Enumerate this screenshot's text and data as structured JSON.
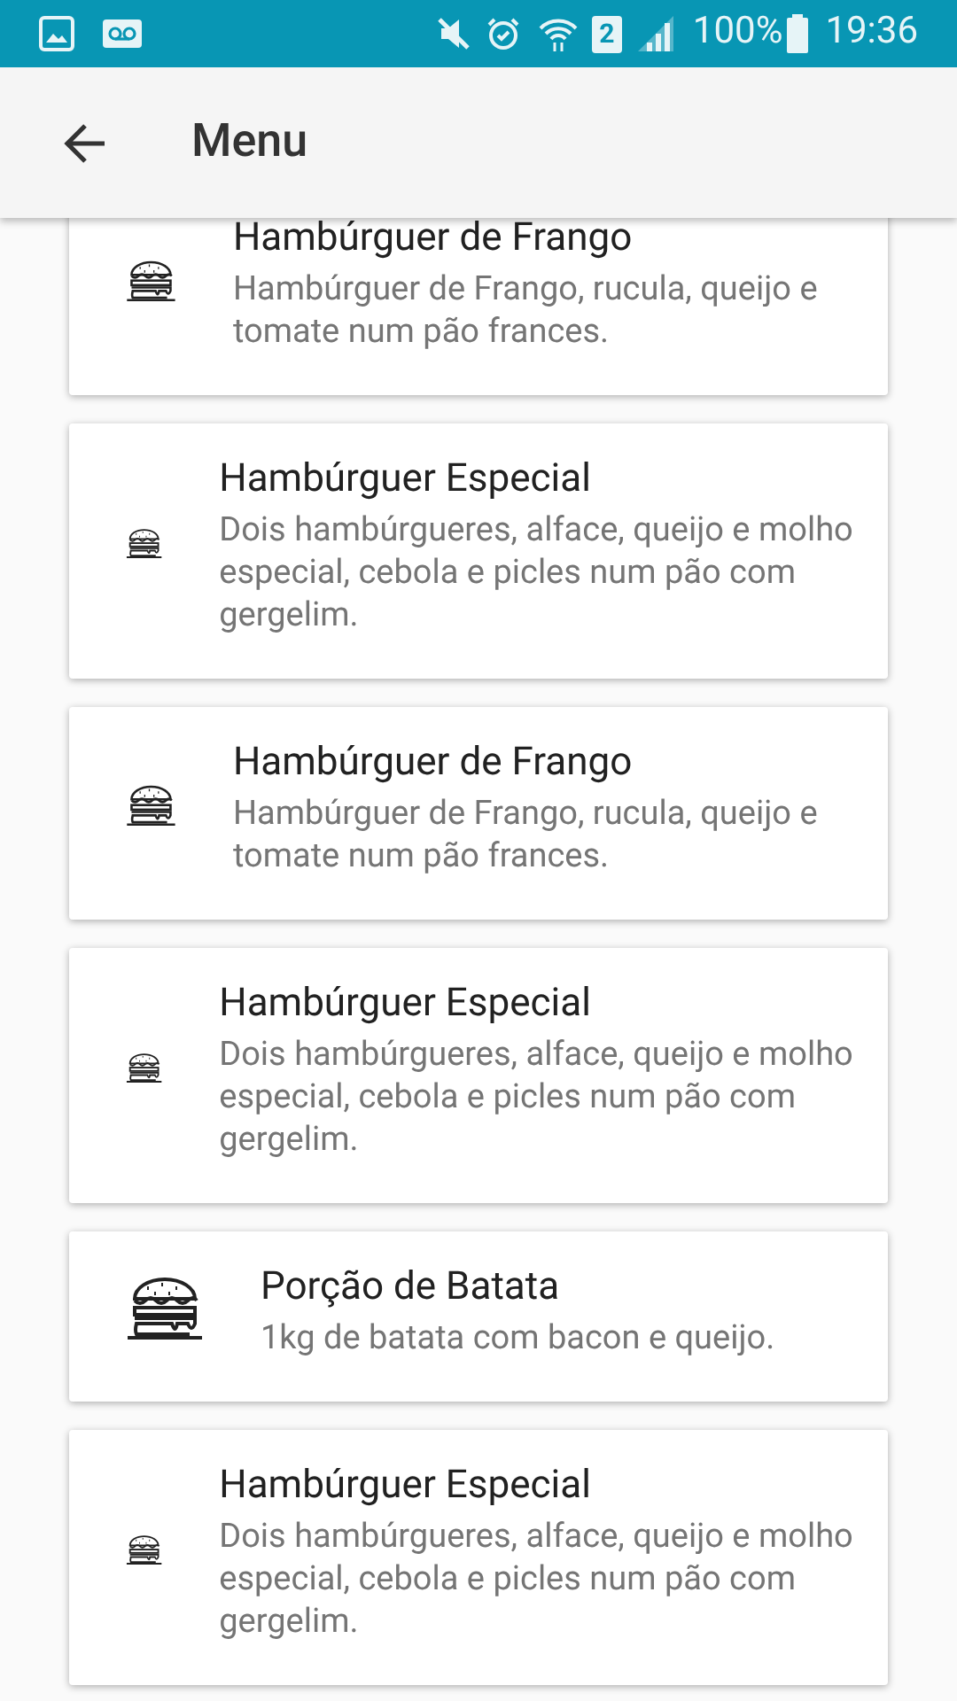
{
  "status_bar": {
    "battery": "100%",
    "time": "19:36",
    "sim": "2"
  },
  "app_bar": {
    "title": "Menu"
  },
  "items": [
    {
      "title": "Hambúrguer de Frango",
      "description": "Hambúrguer de Frango, rucula, queijo e tomate num pão frances."
    },
    {
      "title": "Hambúrguer Especial",
      "description": "Dois hambúrgueres, alface, queijo e molho especial, cebola e picles num pão com gergelim."
    },
    {
      "title": "Hambúrguer de Frango",
      "description": "Hambúrguer de Frango, rucula, queijo e tomate num pão frances."
    },
    {
      "title": "Hambúrguer Especial",
      "description": "Dois hambúrgueres, alface, queijo e molho especial, cebola e picles num pão com gergelim."
    },
    {
      "title": "Porção de Batata",
      "description": "1kg de batata com bacon e queijo."
    },
    {
      "title": "Hambúrguer Especial",
      "description": "Dois hambúrgueres, alface, queijo e molho especial, cebola e picles num pão com gergelim."
    }
  ]
}
